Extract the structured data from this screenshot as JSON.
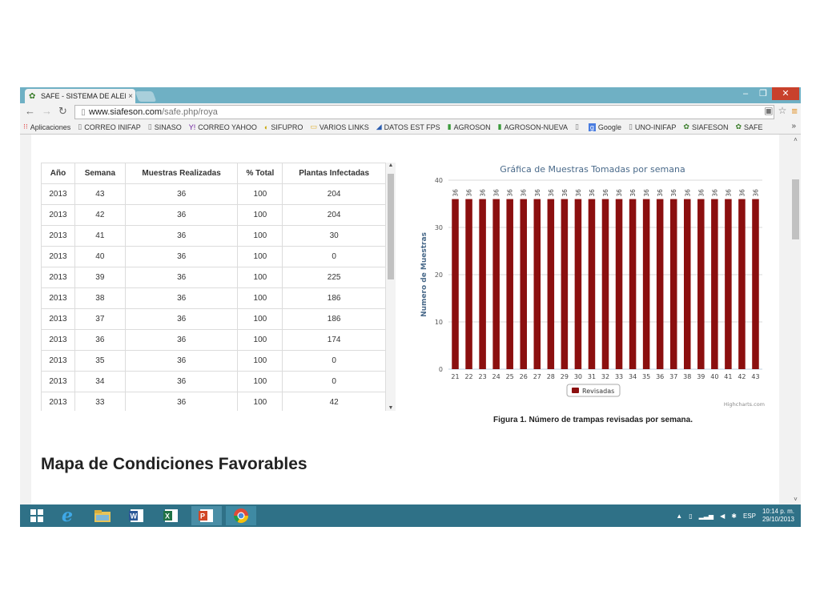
{
  "browser": {
    "tab_title": "SAFE - SISTEMA DE ALERT",
    "url_host": "www.siafeson.com",
    "url_path": "/safe.php/roya",
    "bookmarks": [
      "Aplicaciones",
      "CORREO INIFAP",
      "SINASO",
      "CORREO YAHOO",
      "SIFUPRO",
      "VARIOS LINKS",
      "DATOS EST FPS",
      "AGROSON",
      "AGROSON-NUEVA",
      "",
      "Google",
      "UNO-INIFAP",
      "SIAFESON",
      "SAFE"
    ],
    "bookmark_more": "»"
  },
  "table": {
    "headers": [
      "Año",
      "Semana",
      "Muestras Realizadas",
      "% Total",
      "Plantas Infectadas"
    ],
    "rows": [
      [
        "2013",
        "43",
        "36",
        "100",
        "204"
      ],
      [
        "2013",
        "42",
        "36",
        "100",
        "204"
      ],
      [
        "2013",
        "41",
        "36",
        "100",
        "30"
      ],
      [
        "2013",
        "40",
        "36",
        "100",
        "0"
      ],
      [
        "2013",
        "39",
        "36",
        "100",
        "225"
      ],
      [
        "2013",
        "38",
        "36",
        "100",
        "186"
      ],
      [
        "2013",
        "37",
        "36",
        "100",
        "186"
      ],
      [
        "2013",
        "36",
        "36",
        "100",
        "174"
      ],
      [
        "2013",
        "35",
        "36",
        "100",
        "0"
      ],
      [
        "2013",
        "34",
        "36",
        "100",
        "0"
      ],
      [
        "2013",
        "33",
        "36",
        "100",
        "42"
      ]
    ]
  },
  "chart_data": {
    "type": "bar",
    "title": "Gráfica de Muestras Tomadas por semana",
    "xlabel": "",
    "ylabel": "Numero de Muestras",
    "categories": [
      "21",
      "22",
      "23",
      "24",
      "25",
      "26",
      "27",
      "28",
      "29",
      "30",
      "31",
      "32",
      "33",
      "34",
      "35",
      "36",
      "37",
      "38",
      "39",
      "40",
      "41",
      "42",
      "43"
    ],
    "series": [
      {
        "name": "Revisadas",
        "color": "#8b0f0f",
        "values": [
          36,
          36,
          36,
          36,
          36,
          36,
          36,
          36,
          36,
          36,
          36,
          36,
          36,
          36,
          36,
          36,
          36,
          36,
          36,
          36,
          36,
          36,
          36
        ]
      }
    ],
    "ylim": [
      0,
      40
    ],
    "yticks": [
      "0",
      "10",
      "20",
      "30",
      "40"
    ],
    "data_labels": true,
    "grid": true,
    "legend": "bottom-center",
    "credits": "Highcharts.com"
  },
  "caption": "Figura 1. Número de trampas revisadas por semana.",
  "section_title": "Mapa de Condiciones Favorables",
  "taskbar": {
    "apps": [
      "windows-start",
      "internet-explorer",
      "file-explorer",
      "word",
      "excel",
      "powerpoint",
      "chrome"
    ],
    "tray_lang": "ESP",
    "time": "10:14 p. m.",
    "date": "29/10/2013"
  },
  "colors": {
    "accent": "#6fb0c4",
    "taskbar": "#2f7187",
    "bar": "#8b0f0f",
    "title_text": "#4a6a8a"
  }
}
